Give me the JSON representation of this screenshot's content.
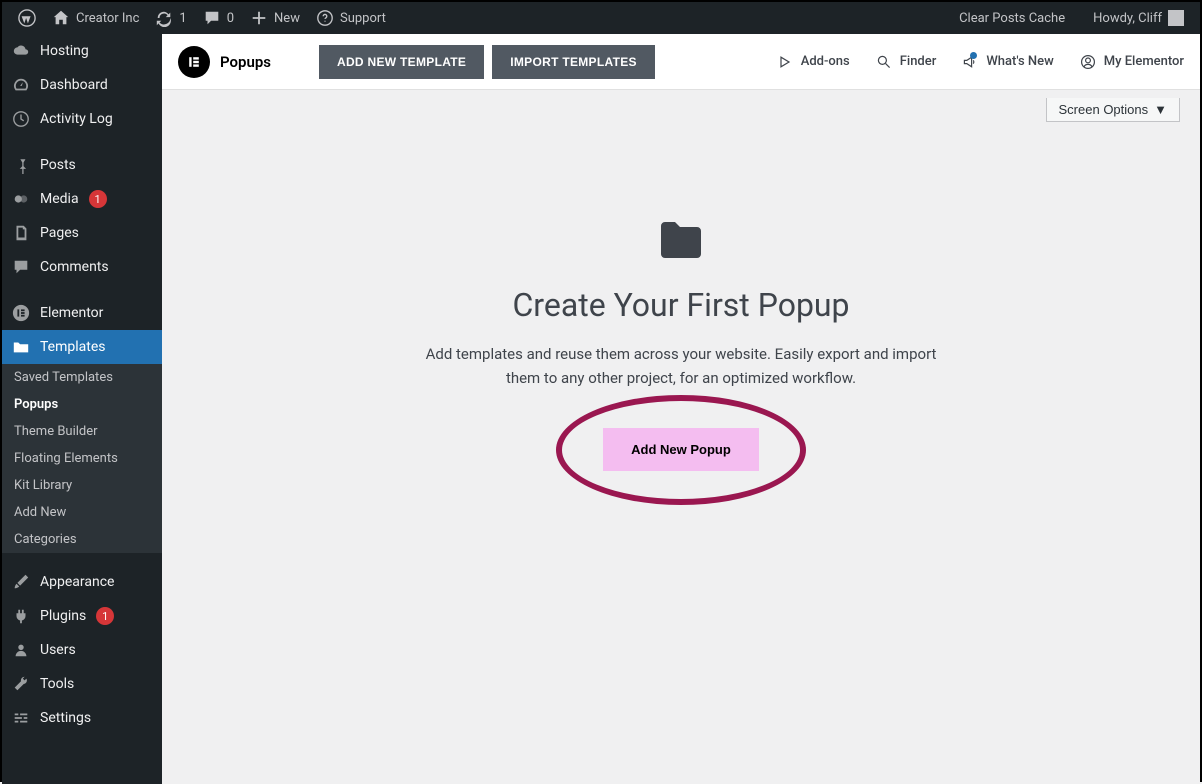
{
  "admin_bar": {
    "site": "Creator Inc",
    "updates": "1",
    "comments": "0",
    "new": "New",
    "support": "Support",
    "clear_cache": "Clear Posts Cache",
    "howdy": "Howdy, Cliff"
  },
  "sidebar": {
    "items": [
      {
        "label": "Hosting"
      },
      {
        "label": "Dashboard"
      },
      {
        "label": "Activity Log"
      },
      {
        "label": "Posts"
      },
      {
        "label": "Media",
        "badge": "1"
      },
      {
        "label": "Pages"
      },
      {
        "label": "Comments"
      },
      {
        "label": "Elementor"
      },
      {
        "label": "Templates",
        "active": true
      },
      {
        "label": "Appearance"
      },
      {
        "label": "Plugins",
        "badge": "1"
      },
      {
        "label": "Users"
      },
      {
        "label": "Tools"
      },
      {
        "label": "Settings"
      }
    ],
    "submenu": [
      {
        "label": "Saved Templates"
      },
      {
        "label": "Popups",
        "active": true
      },
      {
        "label": "Theme Builder"
      },
      {
        "label": "Floating Elements"
      },
      {
        "label": "Kit Library"
      },
      {
        "label": "Add New"
      },
      {
        "label": "Categories"
      }
    ]
  },
  "toolbar": {
    "title": "Popups",
    "add_template": "ADD NEW TEMPLATE",
    "import_templates": "IMPORT TEMPLATES",
    "links": {
      "addons": "Add-ons",
      "finder": "Finder",
      "whatsnew": "What's New",
      "myelementor": "My Elementor"
    }
  },
  "screen_options": "Screen Options",
  "empty": {
    "title": "Create Your First Popup",
    "desc": "Add templates and reuse them across your website. Easily export and import them to any other project, for an optimized workflow.",
    "button": "Add New Popup"
  }
}
